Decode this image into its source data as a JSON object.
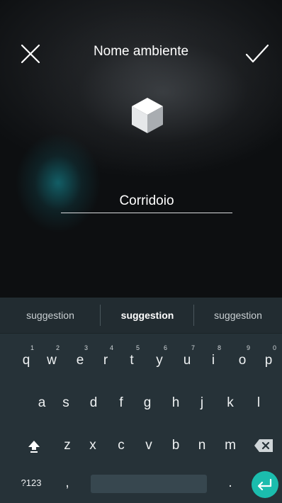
{
  "header": {
    "title": "Nome ambiente",
    "close_icon": "close-icon",
    "confirm_icon": "check-icon"
  },
  "room": {
    "icon": "cube-icon",
    "name_value": "Corridoio"
  },
  "keyboard": {
    "suggestions": [
      "suggestion",
      "suggestion",
      "suggestion"
    ],
    "row1": [
      {
        "key": "q",
        "hint": "1"
      },
      {
        "key": "w",
        "hint": "2"
      },
      {
        "key": "e",
        "hint": "3"
      },
      {
        "key": "r",
        "hint": "4"
      },
      {
        "key": "t",
        "hint": "5"
      },
      {
        "key": "y",
        "hint": "6"
      },
      {
        "key": "u",
        "hint": "7"
      },
      {
        "key": "i",
        "hint": "8"
      },
      {
        "key": "o",
        "hint": "9"
      },
      {
        "key": "p",
        "hint": "0"
      }
    ],
    "row2": [
      "a",
      "s",
      "d",
      "f",
      "g",
      "h",
      "j",
      "k",
      "l"
    ],
    "row3": [
      "z",
      "x",
      "c",
      "v",
      "b",
      "n",
      "m"
    ],
    "shift_icon": "shift-icon",
    "backspace_icon": "backspace-icon",
    "symbols_label": "?123",
    "comma": ",",
    "period": ".",
    "enter_icon": "enter-icon",
    "accent_color": "#1bbcad"
  }
}
